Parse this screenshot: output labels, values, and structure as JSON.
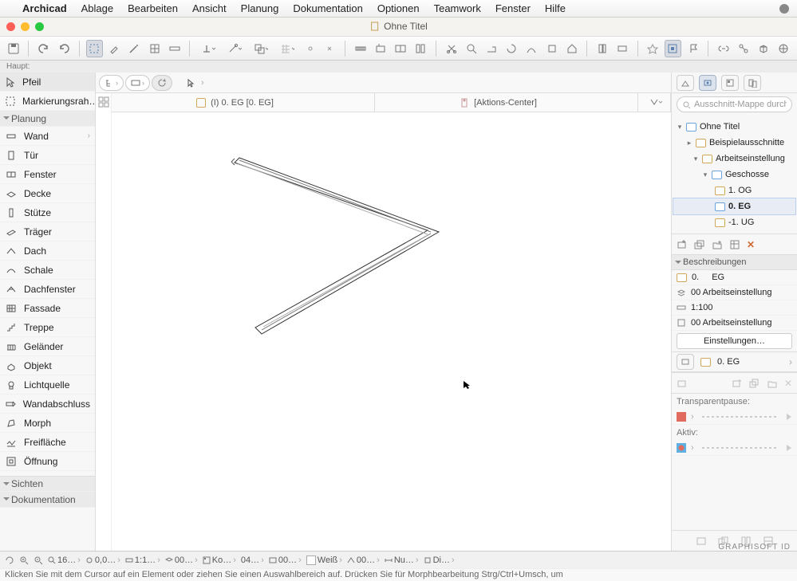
{
  "menubar": {
    "app": "Archicad",
    "items": [
      "Ablage",
      "Bearbeiten",
      "Ansicht",
      "Planung",
      "Dokumentation",
      "Optionen",
      "Teamwork",
      "Fenster",
      "Hilfe"
    ]
  },
  "window": {
    "title": "Ohne Titel"
  },
  "maintb_layer_label": "Haupt:",
  "toolbox": {
    "selected": "Pfeil",
    "marquee": "Markierungsrah…",
    "section": "Planung",
    "tools": [
      "Wand",
      "Tür",
      "Fenster",
      "Decke",
      "Stütze",
      "Träger",
      "Dach",
      "Schale",
      "Dachfenster",
      "Fassade",
      "Treppe",
      "Geländer",
      "Objekt",
      "Lichtquelle",
      "Wandabschluss",
      "Morph",
      "Freifläche",
      "Öffnung"
    ],
    "footer_sections": [
      "Sichten",
      "Dokumentation"
    ]
  },
  "tabs": {
    "a": "(I) 0. EG [0. EG]",
    "b": "[Aktions-Center]"
  },
  "navigator": {
    "search_placeholder": "Ausschnitt-Mappe durch",
    "root": "Ohne Titel",
    "n_beispiel": "Beispielausschnitte",
    "n_arbeit": "Arbeitseinstellung",
    "n_geschosse": "Geschosse",
    "s1": "1. OG",
    "s0": "0. EG",
    "sm1": "-1. UG"
  },
  "props": {
    "head": "Beschreibungen",
    "id_num": "0.",
    "id_name": "EG",
    "r1": "00 Arbeitseinstellung",
    "r2": "1:100",
    "r3": "00 Arbeitseinstellung",
    "settings": "Einstellungen…",
    "combo_story": "0. EG",
    "transp_label": "Transparentpause:",
    "active_label": "Aktiv:"
  },
  "status": {
    "s1": "16…",
    "s2": "0,0…",
    "s3": "1:1…",
    "s4": "00…",
    "s5": "Ko…",
    "s6": "04…",
    "s7": "00…",
    "s8": "Weiß",
    "s9": "00…",
    "s10": "Nu…",
    "s11": "Di…"
  },
  "hint": "Klicken Sie mit dem Cursor auf ein Element oder ziehen Sie einen Auswahlbereich auf. Drücken Sie für Morphbearbeitung Strg/Ctrl+Umsch, um",
  "footer_brand": "GRAPHISOFT ID"
}
